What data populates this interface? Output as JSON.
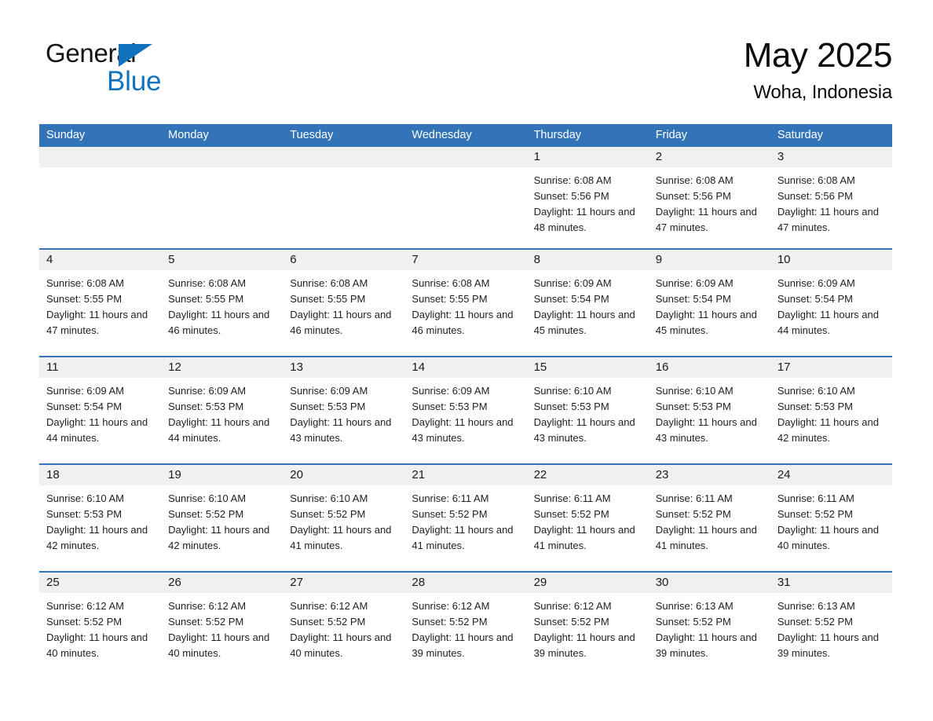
{
  "brand": {
    "name_part1": "General",
    "name_part2": "Blue",
    "triangle_color": "#1272bd",
    "logo_icon": "general-blue-logo"
  },
  "header": {
    "month_title": "May 2025",
    "location": "Woha, Indonesia"
  },
  "theme": {
    "header_blue": "#3274b7",
    "row_divider_blue": "#3274b7",
    "daynum_band": "#f0f0f0",
    "cell_background": "#ffffff",
    "text_color": "#1f1f1f"
  },
  "calendar": {
    "weekday_headers": [
      "Sunday",
      "Monday",
      "Tuesday",
      "Wednesday",
      "Thursday",
      "Friday",
      "Saturday"
    ],
    "weeks": [
      [
        {
          "day": "",
          "sunrise": "",
          "sunset": "",
          "daylight": "",
          "empty": true
        },
        {
          "day": "",
          "sunrise": "",
          "sunset": "",
          "daylight": "",
          "empty": true
        },
        {
          "day": "",
          "sunrise": "",
          "sunset": "",
          "daylight": "",
          "empty": true
        },
        {
          "day": "",
          "sunrise": "",
          "sunset": "",
          "daylight": "",
          "empty": true
        },
        {
          "day": "1",
          "sunrise": "Sunrise: 6:08 AM",
          "sunset": "Sunset: 5:56 PM",
          "daylight": "Daylight: 11 hours and 48 minutes.",
          "empty": false
        },
        {
          "day": "2",
          "sunrise": "Sunrise: 6:08 AM",
          "sunset": "Sunset: 5:56 PM",
          "daylight": "Daylight: 11 hours and 47 minutes.",
          "empty": false
        },
        {
          "day": "3",
          "sunrise": "Sunrise: 6:08 AM",
          "sunset": "Sunset: 5:56 PM",
          "daylight": "Daylight: 11 hours and 47 minutes.",
          "empty": false
        }
      ],
      [
        {
          "day": "4",
          "sunrise": "Sunrise: 6:08 AM",
          "sunset": "Sunset: 5:55 PM",
          "daylight": "Daylight: 11 hours and 47 minutes.",
          "empty": false
        },
        {
          "day": "5",
          "sunrise": "Sunrise: 6:08 AM",
          "sunset": "Sunset: 5:55 PM",
          "daylight": "Daylight: 11 hours and 46 minutes.",
          "empty": false
        },
        {
          "day": "6",
          "sunrise": "Sunrise: 6:08 AM",
          "sunset": "Sunset: 5:55 PM",
          "daylight": "Daylight: 11 hours and 46 minutes.",
          "empty": false
        },
        {
          "day": "7",
          "sunrise": "Sunrise: 6:08 AM",
          "sunset": "Sunset: 5:55 PM",
          "daylight": "Daylight: 11 hours and 46 minutes.",
          "empty": false
        },
        {
          "day": "8",
          "sunrise": "Sunrise: 6:09 AM",
          "sunset": "Sunset: 5:54 PM",
          "daylight": "Daylight: 11 hours and 45 minutes.",
          "empty": false
        },
        {
          "day": "9",
          "sunrise": "Sunrise: 6:09 AM",
          "sunset": "Sunset: 5:54 PM",
          "daylight": "Daylight: 11 hours and 45 minutes.",
          "empty": false
        },
        {
          "day": "10",
          "sunrise": "Sunrise: 6:09 AM",
          "sunset": "Sunset: 5:54 PM",
          "daylight": "Daylight: 11 hours and 44 minutes.",
          "empty": false
        }
      ],
      [
        {
          "day": "11",
          "sunrise": "Sunrise: 6:09 AM",
          "sunset": "Sunset: 5:54 PM",
          "daylight": "Daylight: 11 hours and 44 minutes.",
          "empty": false
        },
        {
          "day": "12",
          "sunrise": "Sunrise: 6:09 AM",
          "sunset": "Sunset: 5:53 PM",
          "daylight": "Daylight: 11 hours and 44 minutes.",
          "empty": false
        },
        {
          "day": "13",
          "sunrise": "Sunrise: 6:09 AM",
          "sunset": "Sunset: 5:53 PM",
          "daylight": "Daylight: 11 hours and 43 minutes.",
          "empty": false
        },
        {
          "day": "14",
          "sunrise": "Sunrise: 6:09 AM",
          "sunset": "Sunset: 5:53 PM",
          "daylight": "Daylight: 11 hours and 43 minutes.",
          "empty": false
        },
        {
          "day": "15",
          "sunrise": "Sunrise: 6:10 AM",
          "sunset": "Sunset: 5:53 PM",
          "daylight": "Daylight: 11 hours and 43 minutes.",
          "empty": false
        },
        {
          "day": "16",
          "sunrise": "Sunrise: 6:10 AM",
          "sunset": "Sunset: 5:53 PM",
          "daylight": "Daylight: 11 hours and 43 minutes.",
          "empty": false
        },
        {
          "day": "17",
          "sunrise": "Sunrise: 6:10 AM",
          "sunset": "Sunset: 5:53 PM",
          "daylight": "Daylight: 11 hours and 42 minutes.",
          "empty": false
        }
      ],
      [
        {
          "day": "18",
          "sunrise": "Sunrise: 6:10 AM",
          "sunset": "Sunset: 5:53 PM",
          "daylight": "Daylight: 11 hours and 42 minutes.",
          "empty": false
        },
        {
          "day": "19",
          "sunrise": "Sunrise: 6:10 AM",
          "sunset": "Sunset: 5:52 PM",
          "daylight": "Daylight: 11 hours and 42 minutes.",
          "empty": false
        },
        {
          "day": "20",
          "sunrise": "Sunrise: 6:10 AM",
          "sunset": "Sunset: 5:52 PM",
          "daylight": "Daylight: 11 hours and 41 minutes.",
          "empty": false
        },
        {
          "day": "21",
          "sunrise": "Sunrise: 6:11 AM",
          "sunset": "Sunset: 5:52 PM",
          "daylight": "Daylight: 11 hours and 41 minutes.",
          "empty": false
        },
        {
          "day": "22",
          "sunrise": "Sunrise: 6:11 AM",
          "sunset": "Sunset: 5:52 PM",
          "daylight": "Daylight: 11 hours and 41 minutes.",
          "empty": false
        },
        {
          "day": "23",
          "sunrise": "Sunrise: 6:11 AM",
          "sunset": "Sunset: 5:52 PM",
          "daylight": "Daylight: 11 hours and 41 minutes.",
          "empty": false
        },
        {
          "day": "24",
          "sunrise": "Sunrise: 6:11 AM",
          "sunset": "Sunset: 5:52 PM",
          "daylight": "Daylight: 11 hours and 40 minutes.",
          "empty": false
        }
      ],
      [
        {
          "day": "25",
          "sunrise": "Sunrise: 6:12 AM",
          "sunset": "Sunset: 5:52 PM",
          "daylight": "Daylight: 11 hours and 40 minutes.",
          "empty": false
        },
        {
          "day": "26",
          "sunrise": "Sunrise: 6:12 AM",
          "sunset": "Sunset: 5:52 PM",
          "daylight": "Daylight: 11 hours and 40 minutes.",
          "empty": false
        },
        {
          "day": "27",
          "sunrise": "Sunrise: 6:12 AM",
          "sunset": "Sunset: 5:52 PM",
          "daylight": "Daylight: 11 hours and 40 minutes.",
          "empty": false
        },
        {
          "day": "28",
          "sunrise": "Sunrise: 6:12 AM",
          "sunset": "Sunset: 5:52 PM",
          "daylight": "Daylight: 11 hours and 39 minutes.",
          "empty": false
        },
        {
          "day": "29",
          "sunrise": "Sunrise: 6:12 AM",
          "sunset": "Sunset: 5:52 PM",
          "daylight": "Daylight: 11 hours and 39 minutes.",
          "empty": false
        },
        {
          "day": "30",
          "sunrise": "Sunrise: 6:13 AM",
          "sunset": "Sunset: 5:52 PM",
          "daylight": "Daylight: 11 hours and 39 minutes.",
          "empty": false
        },
        {
          "day": "31",
          "sunrise": "Sunrise: 6:13 AM",
          "sunset": "Sunset: 5:52 PM",
          "daylight": "Daylight: 11 hours and 39 minutes.",
          "empty": false
        }
      ]
    ]
  }
}
